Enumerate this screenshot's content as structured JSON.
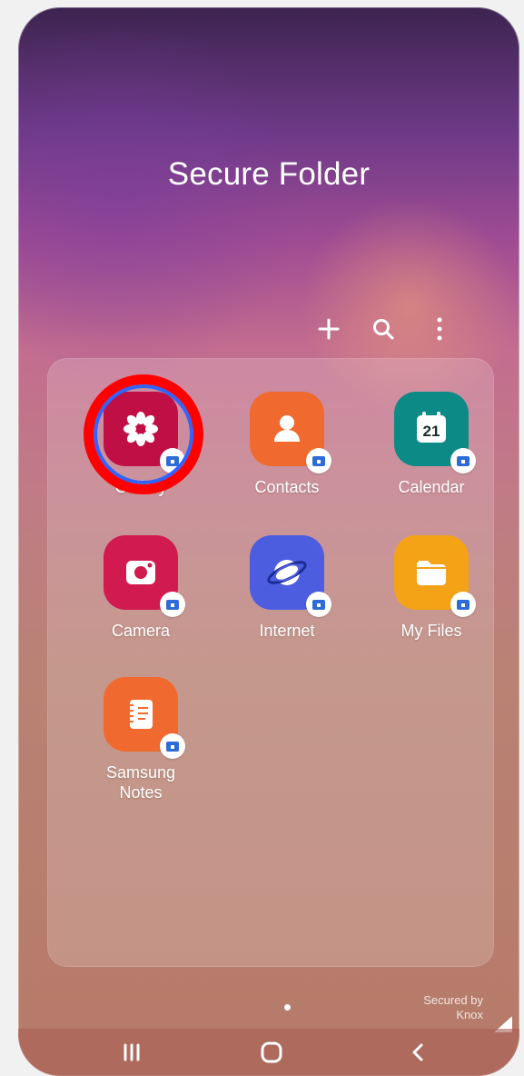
{
  "screen": {
    "title": "Secure Folder",
    "toolbar": [
      {
        "name": "add",
        "icon": "plus-icon"
      },
      {
        "name": "search",
        "icon": "search-icon"
      },
      {
        "name": "more",
        "icon": "more-vertical-icon"
      }
    ],
    "apps": [
      {
        "label": "Gallery",
        "icon": "gallery-icon",
        "bg": "#c00f44"
      },
      {
        "label": "Contacts",
        "icon": "contacts-icon",
        "bg": "#f06a2f"
      },
      {
        "label": "Calendar",
        "icon": "calendar-icon",
        "bg": "#0b8a86",
        "date": "21"
      },
      {
        "label": "Camera",
        "icon": "camera-icon",
        "bg": "#d11a4d"
      },
      {
        "label": "Internet",
        "icon": "internet-icon",
        "bg": "#4c5de0"
      },
      {
        "label": "My Files",
        "icon": "folder-icon",
        "bg": "#f4a316"
      },
      {
        "label": "Samsung Notes",
        "icon": "notes-icon",
        "bg": "#f06a2f"
      }
    ],
    "page_indicator": "•",
    "secured_by": "Secured by",
    "knox": "Knox",
    "nav": {
      "recent": "recent-apps-icon",
      "home": "home-icon",
      "back": "back-icon"
    }
  }
}
